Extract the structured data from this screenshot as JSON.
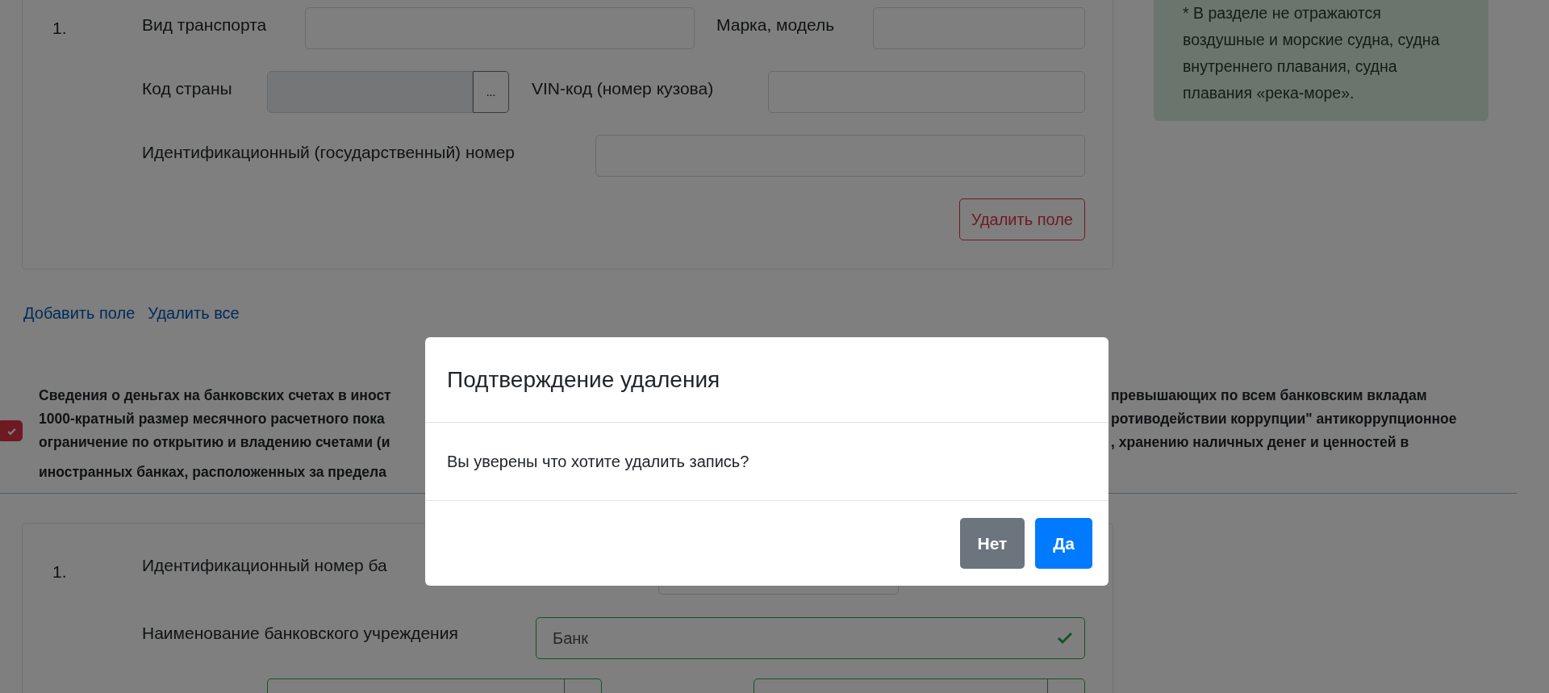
{
  "vehicle_card": {
    "number": "1.",
    "fields": [
      {
        "label": "Вид транспорта",
        "kind": "text"
      },
      {
        "label": "Марка, модель",
        "kind": "text"
      },
      {
        "label": "Код страны",
        "kind": "lookup",
        "button": "..."
      },
      {
        "label": "VIN-код (номер кузова)",
        "kind": "text"
      },
      {
        "label": "Идентификационный (государственный) номер",
        "kind": "text"
      }
    ],
    "delete_button": "Удалить поле"
  },
  "note": "* В разделе не отражаются воздушные и морские судна, судна внутреннего плавания, судна плавания «река-море».",
  "links": [
    "Добавить поле",
    "Удалить все"
  ],
  "bank_section": {
    "checked": true,
    "text_left": [
      "Сведения о деньгах на банковских счетах в иност",
      "1000-кратный размер месячного расчетного пока",
      "ограничение по открытию и владению счетами (и",
      "иностранных банках, расположенных за предела"
    ],
    "text_right": [
      "превышающих по всем банковским вкладам",
      "ротиводействии коррупции\" антикоррупционное",
      ", хранению наличных денег и ценностей в"
    ]
  },
  "bank_card": {
    "number": "1.",
    "fields": [
      {
        "label": "Идентификационный номер ба",
        "valid": false
      },
      {
        "label": "Наименование банковского учреждения",
        "value": "Банк",
        "valid": true
      }
    ]
  },
  "modal": {
    "title": "Подтверждение удаления",
    "message": "Вы уверены что хотите удалить запись?",
    "buttons": [
      {
        "label": "Нет",
        "kind": "secondary"
      },
      {
        "label": "Да",
        "kind": "primary"
      }
    ]
  }
}
